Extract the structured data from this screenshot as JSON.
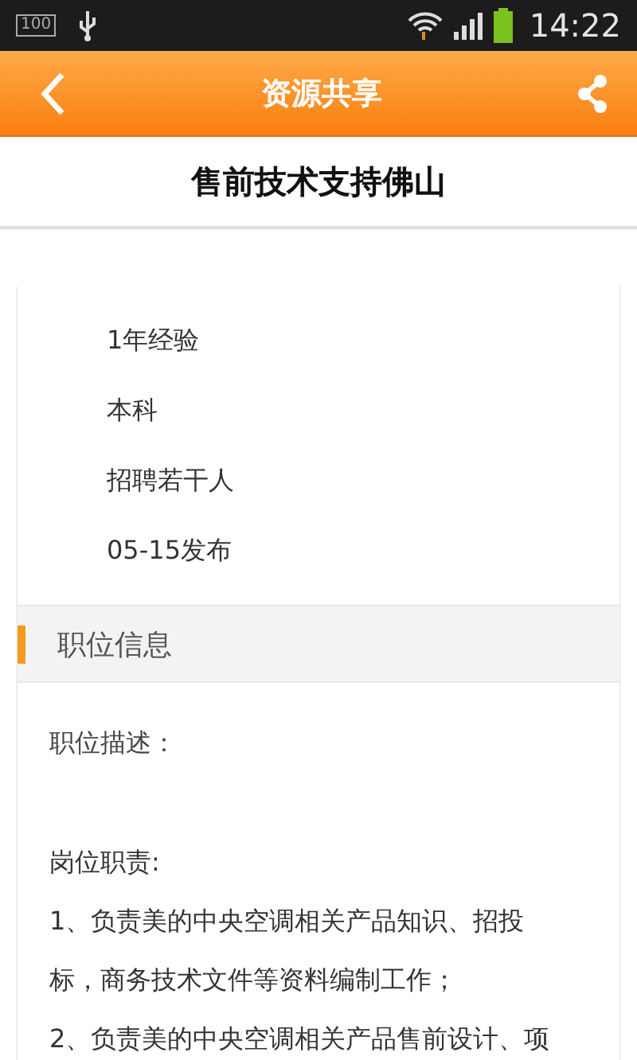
{
  "status_bar": {
    "battery_text": "100",
    "time": "14:22"
  },
  "header": {
    "title": "资源共享"
  },
  "job": {
    "title": "售前技术支持佛山"
  },
  "info": [
    "1年经验",
    "本科",
    "招聘若干人",
    "05-15发布"
  ],
  "section": {
    "title": "职位信息"
  },
  "description": {
    "label": "职位描述：",
    "lines": [
      "岗位职责:",
      "1、负责美的中央空调相关产品知识、招投",
      "标，商务技术文件等资料编制工作；",
      "2、负责美的中央空调相关产品售前设计、项"
    ]
  }
}
